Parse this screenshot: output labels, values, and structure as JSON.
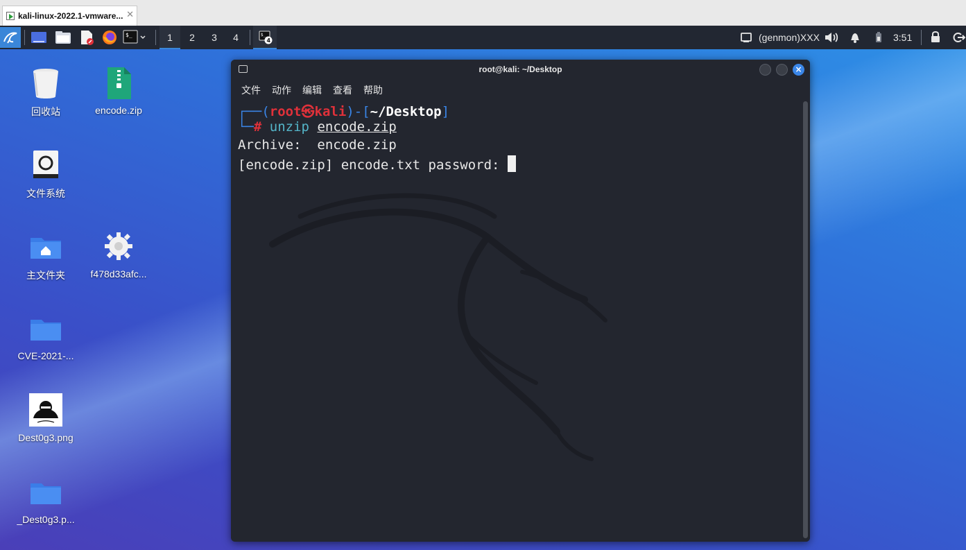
{
  "vmware": {
    "tab_label": "kali-linux-2022.1-vmware...",
    "tab_close": "✕"
  },
  "panel": {
    "workspaces": [
      "1",
      "2",
      "3",
      "4"
    ],
    "active_workspace": "1",
    "task_badge": "4",
    "genmon": "(genmon)XXX",
    "time": "3:51"
  },
  "desktop": {
    "icons": [
      {
        "label": "回收站",
        "icon": "trash-icon"
      },
      {
        "label": "encode.zip",
        "icon": "zip-file-icon"
      },
      {
        "label": "文件系统",
        "icon": "filesystem-icon"
      },
      {
        "label": "主文件夹",
        "icon": "home-folder-icon"
      },
      {
        "label": "f478d33afc...",
        "icon": "gear-icon"
      },
      {
        "label": "CVE-2021-...",
        "icon": "folder-icon"
      },
      {
        "label": "Dest0g3.png",
        "icon": "image-file-icon"
      },
      {
        "label": "_Dest0g3.p...",
        "icon": "folder-icon"
      }
    ]
  },
  "terminal": {
    "title": "root@kali: ~/Desktop",
    "menu": [
      "文件",
      "动作",
      "编辑",
      "查看",
      "帮助"
    ],
    "prompt": {
      "corner_top": "┌──(",
      "user": "root",
      "at": "㉿",
      "host": "kali",
      "mid": ")-[",
      "dir": "~/Desktop",
      "end": "]",
      "corner_bottom": "└─",
      "hash": "#"
    },
    "command": {
      "name": "unzip",
      "arg": "encode.zip"
    },
    "output": [
      "Archive:  encode.zip",
      "[encode.zip] encode.txt password: "
    ]
  },
  "colors": {
    "accent": "#3a86e8",
    "prompt_red": "#e0313a",
    "terminal_bg": "#23262f",
    "panel_bg": "#222732"
  }
}
